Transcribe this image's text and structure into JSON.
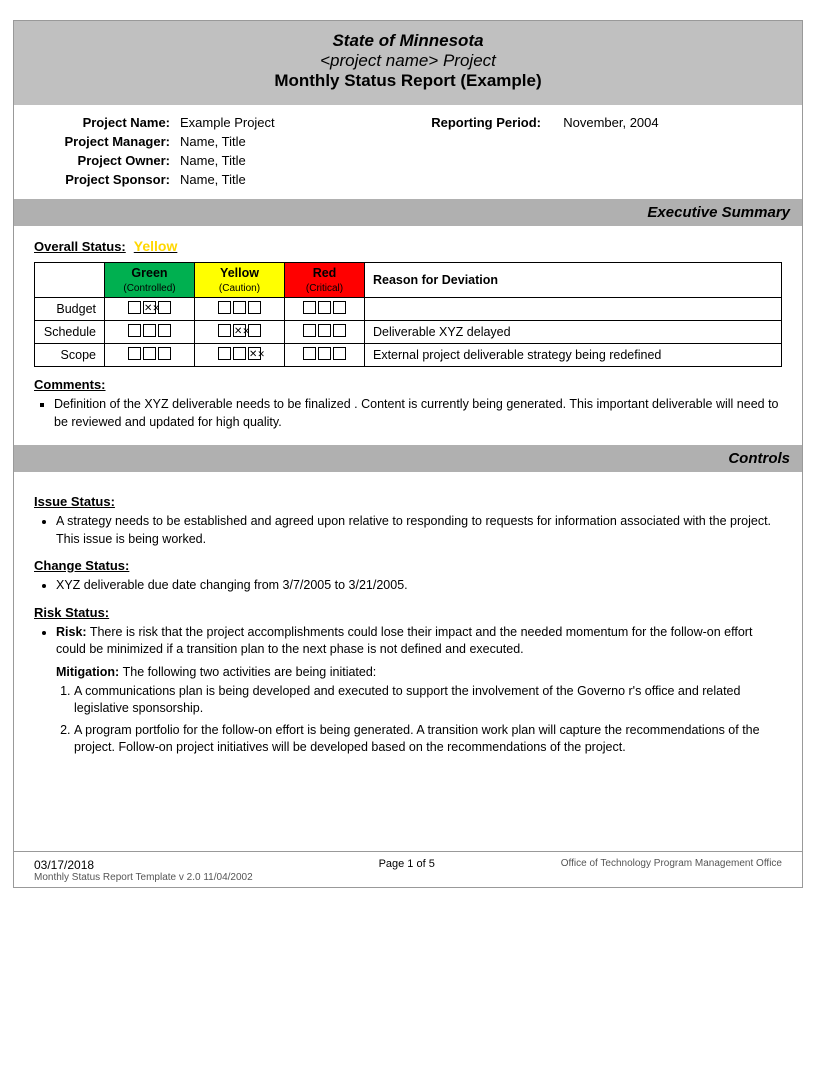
{
  "header": {
    "line1": "State of Minnesota",
    "line2": "<project name> Project",
    "line3": "Monthly Status Report (Example)"
  },
  "project_info": {
    "project_name_label": "Project Name:",
    "project_name_value": "Example Project",
    "reporting_period_label": "Reporting Period:",
    "reporting_period_value": "November, 2004",
    "project_manager_label": "Project Manager:",
    "project_manager_value": "Name, Title",
    "project_owner_label": "Project Owner:",
    "project_owner_value": "Name, Title",
    "project_sponsor_label": "Project Sponsor:",
    "project_sponsor_value": "Name, Title"
  },
  "executive_summary": {
    "title": "Executive Summary",
    "overall_status_label": "Overall Status:",
    "overall_status_value": "Yellow",
    "green_label": "Green",
    "green_sub": "(Controlled)",
    "yellow_label": "Yellow",
    "yellow_sub": "(Caution)",
    "red_label": "Red",
    "red_sub": "(Critical)",
    "reason_header": "Reason for Deviation",
    "rows": [
      {
        "label": "Budget",
        "green_checks": [
          false,
          true,
          false
        ],
        "yellow_checks": [
          false,
          false,
          false
        ],
        "red_checks": [
          false,
          false,
          false
        ],
        "reason": ""
      },
      {
        "label": "Schedule",
        "green_checks": [
          false,
          false,
          false
        ],
        "yellow_checks": [
          false,
          true,
          false
        ],
        "red_checks": [
          false,
          false,
          false
        ],
        "reason": "Deliverable XYZ delayed"
      },
      {
        "label": "Scope",
        "green_checks": [
          false,
          false,
          false
        ],
        "yellow_checks": [
          false,
          false,
          true
        ],
        "red_checks": [
          false,
          false,
          false
        ],
        "reason": "External project deliverable strategy being redefined"
      }
    ],
    "comments_label": "Comments:",
    "comments": [
      "Definition of the XYZ deliverable  needs to be finalized .  Content is currently being generated.  This important deliverable will need to be reviewed and updated for high quality."
    ]
  },
  "controls": {
    "title": "Controls",
    "issue_status_label": "Issue Status:",
    "issue_bullets": [
      "A strategy needs to be established  and agreed upon relative to  responding to  requests for information associated with the project.  This issue is being worked."
    ],
    "change_status_label": "Change Status:",
    "change_bullets": [
      "XYZ  deliverable due date changing from   3/7/2005 to 3/21/2005."
    ],
    "risk_status_label": "Risk Status:",
    "risk_bullets": [
      "Risk: There is risk that the  project accomplishments could lose their impact and the needed momentum for the follow-on effort could be   minimized if a transition plan to the next phase is not defined and executed."
    ],
    "mitigation_label": "Mitigation:",
    "mitigation_intro": "The following two activities are being initiated:",
    "mitigation_items": [
      "A communications plan is being developed and executed to support the involvement of the Governo r's office and related legislative sponsorship.",
      "A program portfolio for the follow-on effort is being generated.  A transition work plan will capture the recommendations of the project. Follow-on project initiatives will be developed based on the recommendations of the project."
    ]
  },
  "footer": {
    "date": "03/17/2018",
    "template_info": "Monthly Status Report Template  v 2.0  11/04/2002",
    "page_info": "Page 1 of 5",
    "office": "Office of Technology Program Management Office"
  }
}
